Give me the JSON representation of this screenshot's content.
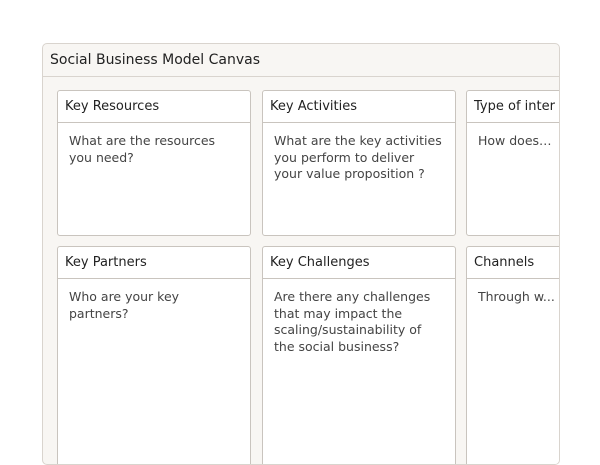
{
  "canvas": {
    "title": "Social Business Model Canvas",
    "cards": [
      {
        "title": "Key Resources",
        "body": "What are the resources you need?"
      },
      {
        "title": "Key Activities",
        "body": "What are the key activities you perform to deliver your value proposition ?"
      },
      {
        "title": "Type of inter",
        "body": "How does y..."
      },
      {
        "title": "Key Partners",
        "body": "Who are your key partners?"
      },
      {
        "title": "Key Challenges",
        "body": "Are there any challenges that may impact the scaling/sustainability of the social business?"
      },
      {
        "title": "Channels",
        "body": "Through w..."
      }
    ]
  }
}
